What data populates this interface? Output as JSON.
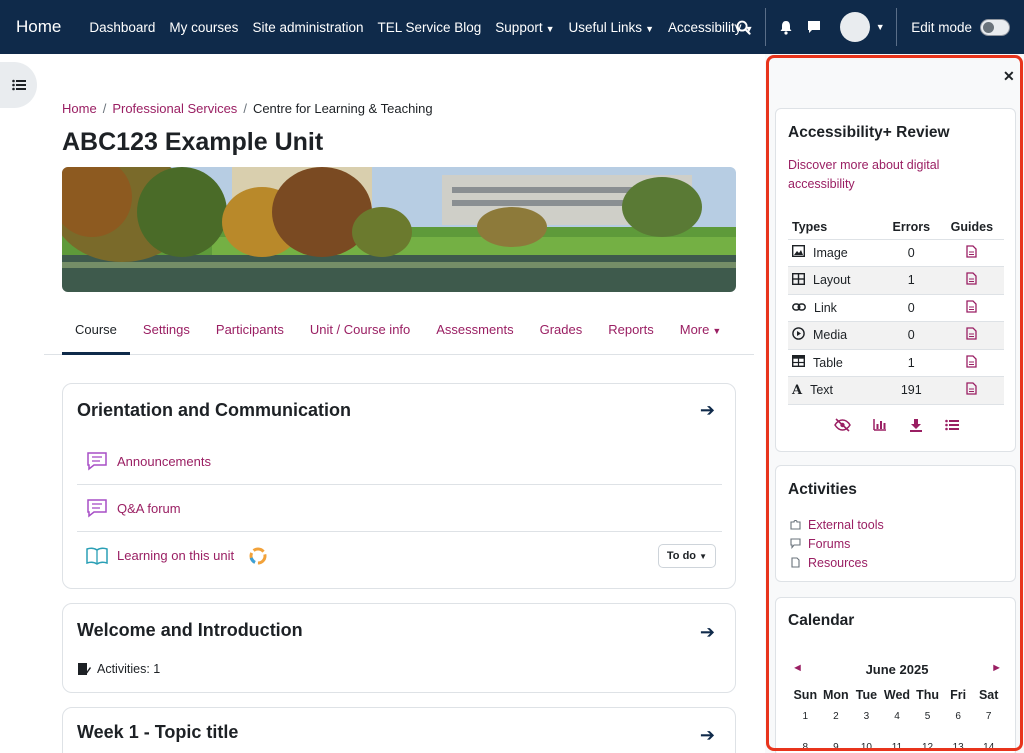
{
  "navbar": {
    "brand": "Home",
    "links": [
      {
        "label": "Dashboard",
        "caret": false
      },
      {
        "label": "My courses",
        "caret": false
      },
      {
        "label": "Site administration",
        "caret": false
      },
      {
        "label": "TEL Service Blog",
        "caret": false
      },
      {
        "label": "Support",
        "caret": true
      },
      {
        "label": "Useful Links",
        "caret": true
      },
      {
        "label": "Accessibility",
        "caret": true
      }
    ],
    "edit_mode_label": "Edit mode"
  },
  "breadcrumb": {
    "items": [
      "Home",
      "Professional Services",
      "Centre for Learning & Teaching"
    ]
  },
  "page": {
    "title": "ABC123 Example Unit"
  },
  "tabs": [
    "Course",
    "Settings",
    "Participants",
    "Unit / Course info",
    "Assessments",
    "Grades",
    "Reports",
    "More"
  ],
  "sections": [
    {
      "title": "Orientation and Communication",
      "activities": [
        {
          "label": "Announcements",
          "icon": "forum-icon"
        },
        {
          "label": "Q&A forum",
          "icon": "forum-icon"
        },
        {
          "label": "Learning on this unit",
          "icon": "book-icon",
          "todo": "To do"
        }
      ]
    },
    {
      "title": "Welcome and Introduction",
      "meta": "Activities: 1"
    },
    {
      "title": "Week 1 - Topic title"
    }
  ],
  "drawer": {
    "accessibility": {
      "title": "Accessibility+ Review",
      "link": "Discover more about digital accessibility",
      "headers": [
        "Types",
        "Errors",
        "Guides"
      ],
      "rows": [
        {
          "type": "Image",
          "errors": "0",
          "icon": "image-icon"
        },
        {
          "type": "Layout",
          "errors": "1",
          "icon": "layout-grid-icon"
        },
        {
          "type": "Link",
          "errors": "0",
          "icon": "link-icon"
        },
        {
          "type": "Media",
          "errors": "0",
          "icon": "play-circle-icon"
        },
        {
          "type": "Table",
          "errors": "1",
          "icon": "table-icon"
        },
        {
          "type": "Text",
          "errors": "191",
          "icon": "text-a-icon"
        }
      ]
    },
    "activities": {
      "title": "Activities",
      "items": [
        "External tools",
        "Forums",
        "Resources"
      ]
    },
    "calendar": {
      "title": "Calendar",
      "month": "June 2025",
      "prev": "◄",
      "next": "►",
      "days": [
        "Sun",
        "Mon",
        "Tue",
        "Wed",
        "Thu",
        "Fri",
        "Sat"
      ],
      "dates": [
        "1",
        "2",
        "3",
        "4",
        "5",
        "6",
        "7",
        "8",
        "9",
        "10",
        "11",
        "12",
        "13",
        "14"
      ]
    }
  },
  "colors": {
    "navbar": "#0f2a4a",
    "link": "#9a1f63",
    "highlight_frame": "#e8341c"
  }
}
